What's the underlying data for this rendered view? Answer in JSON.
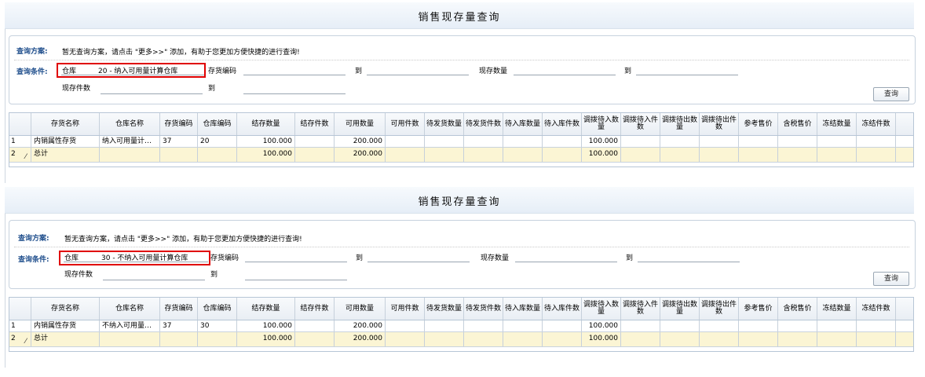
{
  "panels": [
    {
      "title": "销售现存量查询",
      "scheme_label": "查询方案:",
      "scheme_hint": "暂无查询方案，请点击 \"更多>>\" 添加，有助于您更加方便快捷的进行查询!",
      "cond_label": "查询条件:",
      "warehouse_label": "仓库",
      "warehouse_value": "20 - 纳入可用量计算仓库",
      "item_code_label": "存货编码",
      "to1": "到",
      "stock_qty_label": "现存数量",
      "to2": "到",
      "stock_pieces_label": "现存件数",
      "to3": "到",
      "query_button": "查询",
      "row": {
        "num": "1",
        "name": "内销属性存货",
        "wh_name": "纳入可用量计…",
        "item_code": "37",
        "wh_code": "20",
        "stock_qty": "100.000",
        "avail_qty": "200.000",
        "transfer_in_qty": "100.000"
      },
      "total": {
        "num": "2",
        "name": "总计",
        "stock_qty": "100.000",
        "avail_qty": "200.000",
        "transfer_in_qty": "100.000"
      }
    },
    {
      "title": "销售现存量查询",
      "scheme_label": "查询方案:",
      "scheme_hint": "暂无查询方案，请点击 \"更多>>\" 添加，有助于您更加方便快捷的进行查询!",
      "cond_label": "查询条件:",
      "warehouse_label": "仓库",
      "warehouse_value": "30 - 不纳入可用量计算仓库",
      "item_code_label": "存货编码",
      "to1": "到",
      "stock_qty_label": "现存数量",
      "to2": "到",
      "stock_pieces_label": "现存件数",
      "to3": "到",
      "query_button": "查询",
      "row": {
        "num": "1",
        "name": "内销属性存货",
        "wh_name": "不纳入可用量…",
        "item_code": "37",
        "wh_code": "30",
        "stock_qty": "100.000",
        "avail_qty": "200.000",
        "transfer_in_qty": "100.000"
      },
      "total": {
        "num": "2",
        "name": "总计",
        "stock_qty": "100.000",
        "avail_qty": "200.000",
        "transfer_in_qty": "100.000"
      }
    }
  ],
  "columns": [
    "存货名称",
    "仓库名称",
    "存货编码",
    "仓库编码",
    "结存数量",
    "结存件数",
    "可用数量",
    "可用件数",
    "待发货数量",
    "待发货件数",
    "待入库数量",
    "待入库件数",
    "调拨待入数量",
    "调拨待入件数",
    "调拨待出数量",
    "调拨待出件数",
    "参考售价",
    "含税售价",
    "冻结数量",
    "冻结件数"
  ]
}
